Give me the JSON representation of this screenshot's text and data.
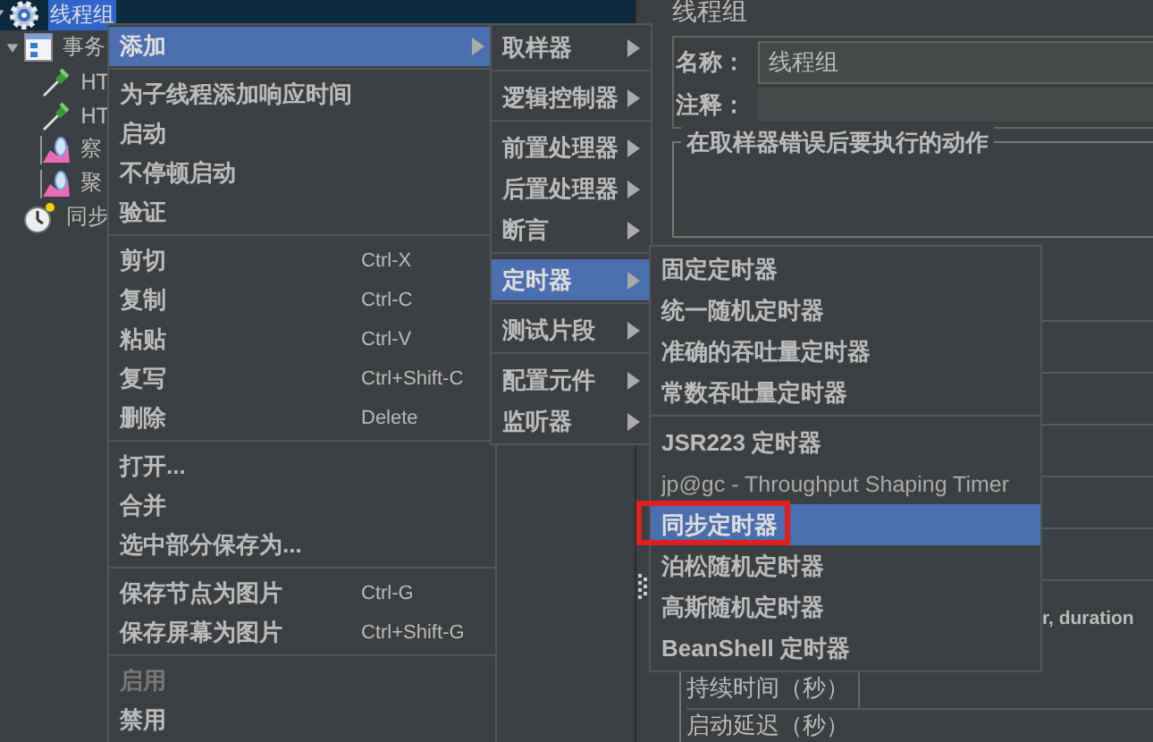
{
  "tree": {
    "items": [
      {
        "label": "线程组",
        "kind": "thread-group",
        "selected": true,
        "expanded": true,
        "children": [
          {
            "label": "事务",
            "kind": "transaction",
            "selected": false,
            "expanded": true,
            "children": [
              {
                "label": "HT",
                "kind": "sampler",
                "selected": false
              },
              {
                "label": "HT",
                "kind": "sampler",
                "selected": false
              },
              {
                "label": "察",
                "kind": "listener",
                "selected": false
              },
              {
                "label": "聚",
                "kind": "listener",
                "selected": false
              }
            ]
          },
          {
            "label": "同步",
            "kind": "timer",
            "selected": false
          }
        ]
      }
    ]
  },
  "panel": {
    "title": "线程组",
    "name_label": "名称：",
    "name_value": "线程组",
    "comment_label": "注释：",
    "action_group_title": "在取样器错误后要执行的动作",
    "cut_text": "r, duration",
    "duration_label": "持续时间（秒）",
    "delay_label": "启动延迟（秒）"
  },
  "context_menu": {
    "items": [
      {
        "kind": "item",
        "label": "添加",
        "submenu": true,
        "selected": true,
        "disabled": false
      },
      {
        "kind": "separator"
      },
      {
        "kind": "item",
        "label": "为子线程添加响应时间",
        "submenu": false,
        "selected": false,
        "disabled": false
      },
      {
        "kind": "item",
        "label": "启动",
        "submenu": false,
        "selected": false,
        "disabled": false
      },
      {
        "kind": "item",
        "label": "不停顿启动",
        "submenu": false,
        "selected": false,
        "disabled": false
      },
      {
        "kind": "item",
        "label": "验证",
        "submenu": false,
        "selected": false,
        "disabled": false
      },
      {
        "kind": "separator"
      },
      {
        "kind": "item",
        "label": "剪切",
        "shortcut": "Ctrl-X",
        "submenu": false,
        "selected": false,
        "disabled": false
      },
      {
        "kind": "item",
        "label": "复制",
        "shortcut": "Ctrl-C",
        "submenu": false,
        "selected": false,
        "disabled": false
      },
      {
        "kind": "item",
        "label": "粘贴",
        "shortcut": "Ctrl-V",
        "submenu": false,
        "selected": false,
        "disabled": false
      },
      {
        "kind": "item",
        "label": "复写",
        "shortcut": "Ctrl+Shift-C",
        "submenu": false,
        "selected": false,
        "disabled": false
      },
      {
        "kind": "item",
        "label": "删除",
        "shortcut": "Delete",
        "submenu": false,
        "selected": false,
        "disabled": false
      },
      {
        "kind": "separator"
      },
      {
        "kind": "item",
        "label": "打开...",
        "submenu": false,
        "selected": false,
        "disabled": false
      },
      {
        "kind": "item",
        "label": "合并",
        "submenu": false,
        "selected": false,
        "disabled": false
      },
      {
        "kind": "item",
        "label": "选中部分保存为...",
        "submenu": false,
        "selected": false,
        "disabled": false
      },
      {
        "kind": "separator"
      },
      {
        "kind": "item",
        "label": "保存节点为图片",
        "shortcut": "Ctrl-G",
        "submenu": false,
        "selected": false,
        "disabled": false
      },
      {
        "kind": "item",
        "label": "保存屏幕为图片",
        "shortcut": "Ctrl+Shift-G",
        "submenu": false,
        "selected": false,
        "disabled": false
      },
      {
        "kind": "separator"
      },
      {
        "kind": "item",
        "label": "启用",
        "submenu": false,
        "selected": false,
        "disabled": true
      },
      {
        "kind": "item",
        "label": "禁用",
        "submenu": false,
        "selected": false,
        "disabled": false
      }
    ]
  },
  "add_menu": {
    "items": [
      {
        "kind": "item",
        "label": "取样器",
        "submenu": true,
        "selected": false
      },
      {
        "kind": "separator"
      },
      {
        "kind": "item",
        "label": "逻辑控制器",
        "submenu": true,
        "selected": false
      },
      {
        "kind": "separator"
      },
      {
        "kind": "item",
        "label": "前置处理器",
        "submenu": true,
        "selected": false
      },
      {
        "kind": "item",
        "label": "后置处理器",
        "submenu": true,
        "selected": false
      },
      {
        "kind": "item",
        "label": "断言",
        "submenu": true,
        "selected": false
      },
      {
        "kind": "separator"
      },
      {
        "kind": "item",
        "label": "定时器",
        "submenu": true,
        "selected": true
      },
      {
        "kind": "separator"
      },
      {
        "kind": "item",
        "label": "测试片段",
        "submenu": true,
        "selected": false
      },
      {
        "kind": "separator"
      },
      {
        "kind": "item",
        "label": "配置元件",
        "submenu": true,
        "selected": false
      },
      {
        "kind": "item",
        "label": "监听器",
        "submenu": true,
        "selected": false
      }
    ]
  },
  "timer_menu": {
    "items": [
      {
        "kind": "item",
        "label": "固定定时器",
        "selected": false,
        "highlighted": false
      },
      {
        "kind": "item",
        "label": "统一随机定时器",
        "selected": false,
        "highlighted": false
      },
      {
        "kind": "item",
        "label": "准确的吞吐量定时器",
        "selected": false,
        "highlighted": false
      },
      {
        "kind": "item",
        "label": "常数吞吐量定时器",
        "selected": false,
        "highlighted": false
      },
      {
        "kind": "separator"
      },
      {
        "kind": "item",
        "label": "JSR223 定时器",
        "selected": false,
        "highlighted": false
      },
      {
        "kind": "plugin",
        "label": "jp@gc - Throughput Shaping Timer",
        "selected": false,
        "highlighted": false
      },
      {
        "kind": "item",
        "label": "同步定时器",
        "selected": true,
        "highlighted": true
      },
      {
        "kind": "item",
        "label": "泊松随机定时器",
        "selected": false,
        "highlighted": false
      },
      {
        "kind": "item",
        "label": "高斯随机定时器",
        "selected": false,
        "highlighted": false
      },
      {
        "kind": "item",
        "label": "BeanShell 定时器",
        "selected": false,
        "highlighted": false
      }
    ]
  }
}
